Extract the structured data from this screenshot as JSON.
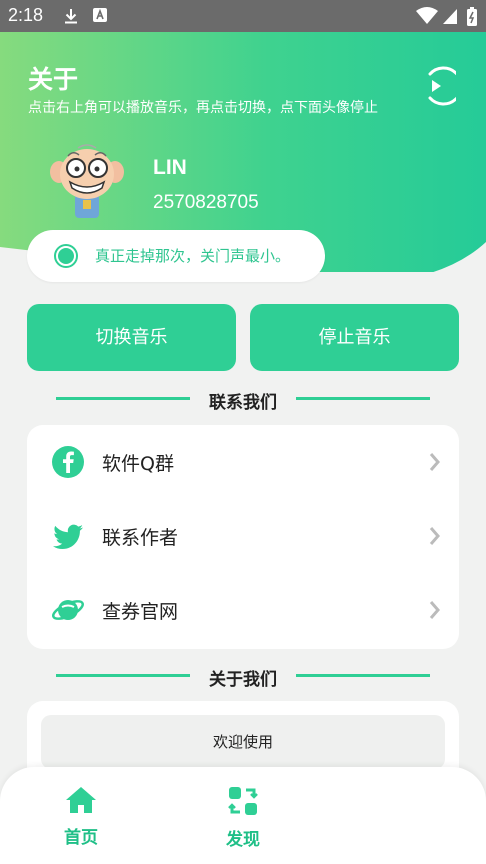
{
  "status_bar": {
    "time": "2:18"
  },
  "header": {
    "title": "关于",
    "subtitle": "点击右上角可以播放音乐，再点击切换，点下面头像停止",
    "user_name": "LIN",
    "user_id": "2570828705"
  },
  "quote": {
    "text": "真正走掉那次，关门声最小。"
  },
  "buttons": {
    "switch_music": "切换音乐",
    "stop_music": "停止音乐"
  },
  "contact": {
    "title": "联系我们",
    "items": [
      {
        "label": "软件Q群",
        "icon": "facebook-icon"
      },
      {
        "label": "联系作者",
        "icon": "twitter-icon"
      },
      {
        "label": "查券官网",
        "icon": "planet-icon"
      }
    ]
  },
  "about": {
    "title": "关于我们",
    "welcome": "欢迎使用"
  },
  "nav": {
    "home": "首页",
    "discover": "发现"
  },
  "colors": {
    "accent": "#2fcf95",
    "header_start": "#86db7e",
    "header_end": "#25cb98"
  }
}
